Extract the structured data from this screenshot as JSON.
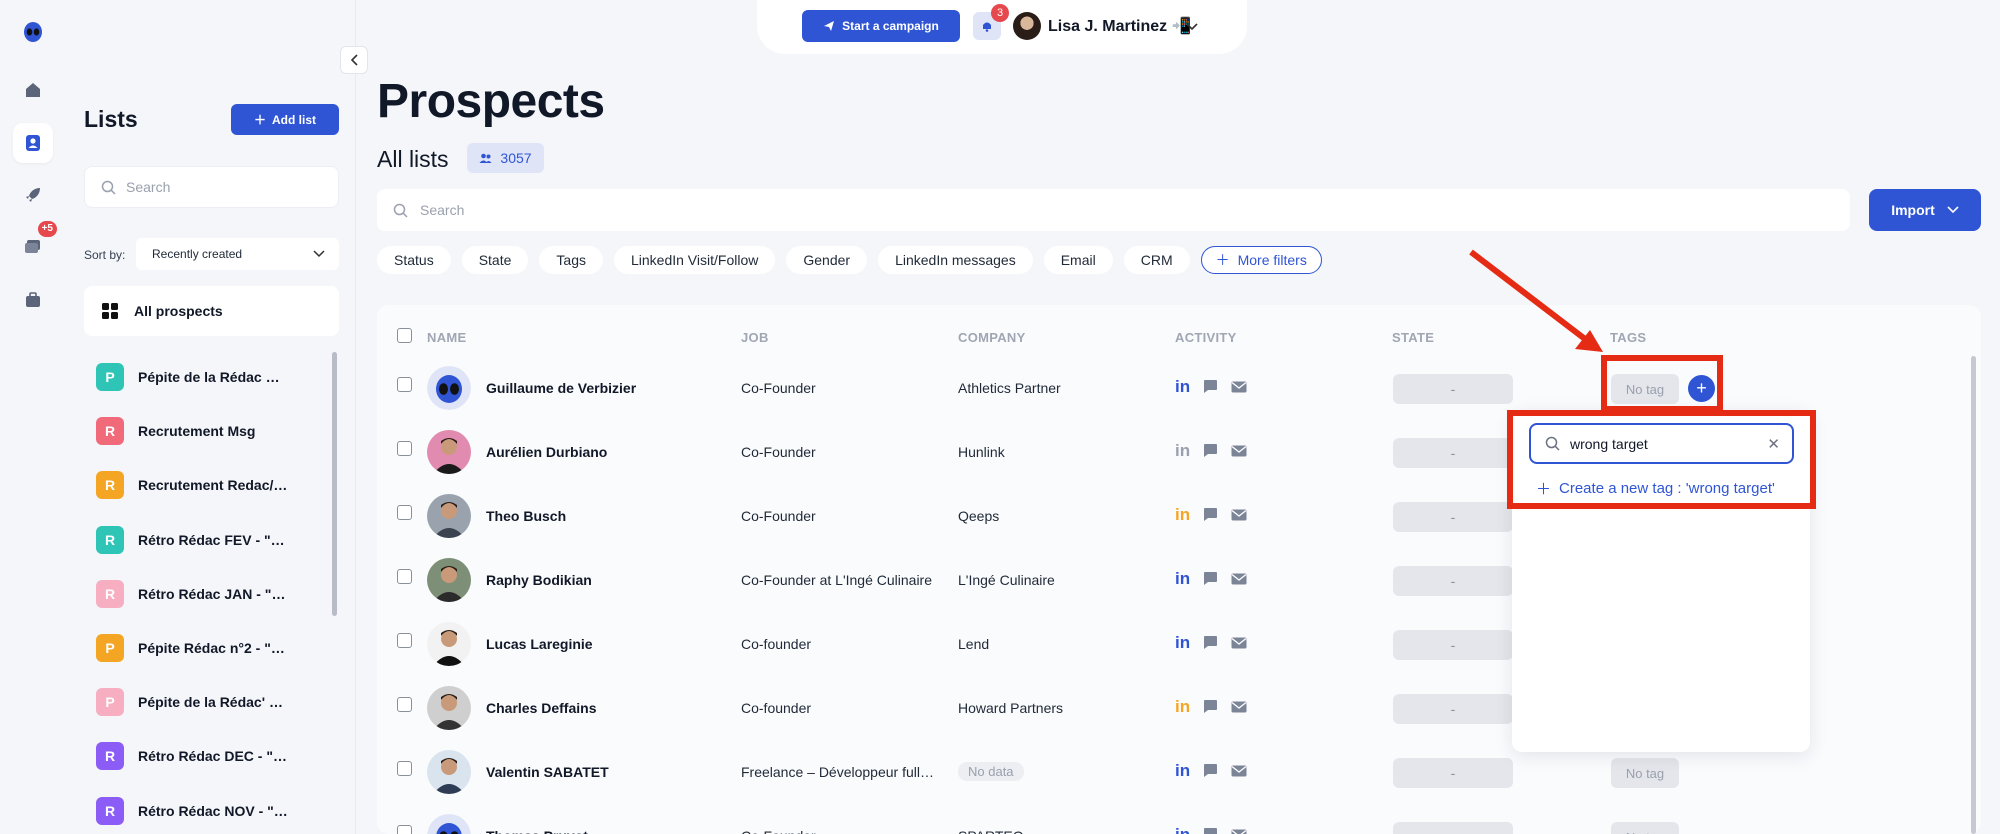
{
  "nav_rail": {
    "items": [
      {
        "icon": "alien-logo-icon"
      },
      {
        "icon": "home-icon"
      },
      {
        "icon": "contacts-icon"
      },
      {
        "icon": "rocket-icon"
      },
      {
        "icon": "messages-icon",
        "badge": "+5"
      },
      {
        "icon": "briefcase-icon"
      }
    ]
  },
  "lists_panel": {
    "title": "Lists",
    "add_button": "Add list",
    "search_placeholder": "Search",
    "sort_label": "Sort by:",
    "sort_value": "Recently created",
    "all_prospects": "All prospects",
    "items": [
      {
        "letter": "P",
        "color": "#2ec4b6",
        "label": "Pépite de la Rédac n°…"
      },
      {
        "letter": "R",
        "color": "#f06a7a",
        "label": "Recrutement Msg"
      },
      {
        "letter": "R",
        "color": "#f5a524",
        "label": "Recrutement Redac/…"
      },
      {
        "letter": "R",
        "color": "#2ec4b6",
        "label": "Rétro Rédac FEV - \"d…"
      },
      {
        "letter": "R",
        "color": "#f7aec0",
        "label": "Rétro Rédac JAN - \"…"
      },
      {
        "letter": "P",
        "color": "#f5a524",
        "label": "Pépite Rédac n°2 - \"…"
      },
      {
        "letter": "P",
        "color": "#f7aec0",
        "label": "Pépite de la Rédac' N…"
      },
      {
        "letter": "R",
        "color": "#8b5cf6",
        "label": "Rétro Rédac DEC - \"…"
      },
      {
        "letter": "R",
        "color": "#8b5cf6",
        "label": "Rétro Rédac NOV - \"…"
      }
    ]
  },
  "topbar": {
    "campaign_button": "Start a campaign",
    "notification_count": "3",
    "user_name": "Lisa J. Martinez"
  },
  "main": {
    "title": "Prospects",
    "subtitle": "All lists",
    "count": "3057",
    "search_placeholder": "Search",
    "import_button": "Import",
    "filters": [
      "Status",
      "State",
      "Tags",
      "LinkedIn Visit/Follow",
      "Gender",
      "LinkedIn messages",
      "Email",
      "CRM"
    ],
    "more_filters": "More filters"
  },
  "table": {
    "columns": [
      "NAME",
      "JOB",
      "COMPANY",
      "ACTIVITY",
      "STATE",
      "TAGS"
    ],
    "rows": [
      {
        "name": "Guillaume de Verbizier",
        "job": "Co-Founder",
        "company": "Athletics Partner",
        "linkedin_color": "#2f55d4",
        "state": "-",
        "tag": "No tag",
        "avatar": "alien"
      },
      {
        "name": "Aurélien Durbiano",
        "job": "Co-Founder",
        "company": "Hunlink",
        "linkedin_color": "#9aa0ad",
        "state": "-",
        "tag": "",
        "avatar": "person-pink"
      },
      {
        "name": "Theo Busch",
        "job": "Co-Founder",
        "company": "Qeeps",
        "linkedin_color": "#f5a524",
        "state": "-",
        "tag": "",
        "avatar": "person-gray"
      },
      {
        "name": "Raphy Bodikian",
        "job": "Co-Founder at L'Ingé Culinaire",
        "company": "L'Ingé Culinaire",
        "linkedin_color": "#2f55d4",
        "state": "-",
        "tag": "",
        "avatar": "person-green"
      },
      {
        "name": "Lucas Lareginie",
        "job": "Co-founder",
        "company": "Lend",
        "linkedin_color": "#2f55d4",
        "state": "-",
        "tag": "",
        "avatar": "person-white"
      },
      {
        "name": "Charles Deffains",
        "job": "Co-founder",
        "company": "Howard Partners",
        "linkedin_color": "#f5a524",
        "state": "-",
        "tag": "",
        "avatar": "person-bw"
      },
      {
        "name": "Valentin SABATET",
        "job": "Freelance – Développeur full-s…",
        "company": "No data",
        "linkedin_color": "#2f55d4",
        "state": "-",
        "tag": "No tag",
        "avatar": "person-light"
      },
      {
        "name": "Thomas Pruvot",
        "job": "Co-Founder",
        "company": "SPARTEO",
        "linkedin_color": "#2f55d4",
        "state": "-",
        "tag": "No tag",
        "avatar": "alien"
      }
    ]
  },
  "tag_dropdown": {
    "search_value": "wrong target",
    "create_label": "Create a new tag : 'wrong target'"
  },
  "colors": {
    "accent": "#2f55d4",
    "annotation_red": "#e62b15",
    "badge_red": "#e5484d"
  }
}
